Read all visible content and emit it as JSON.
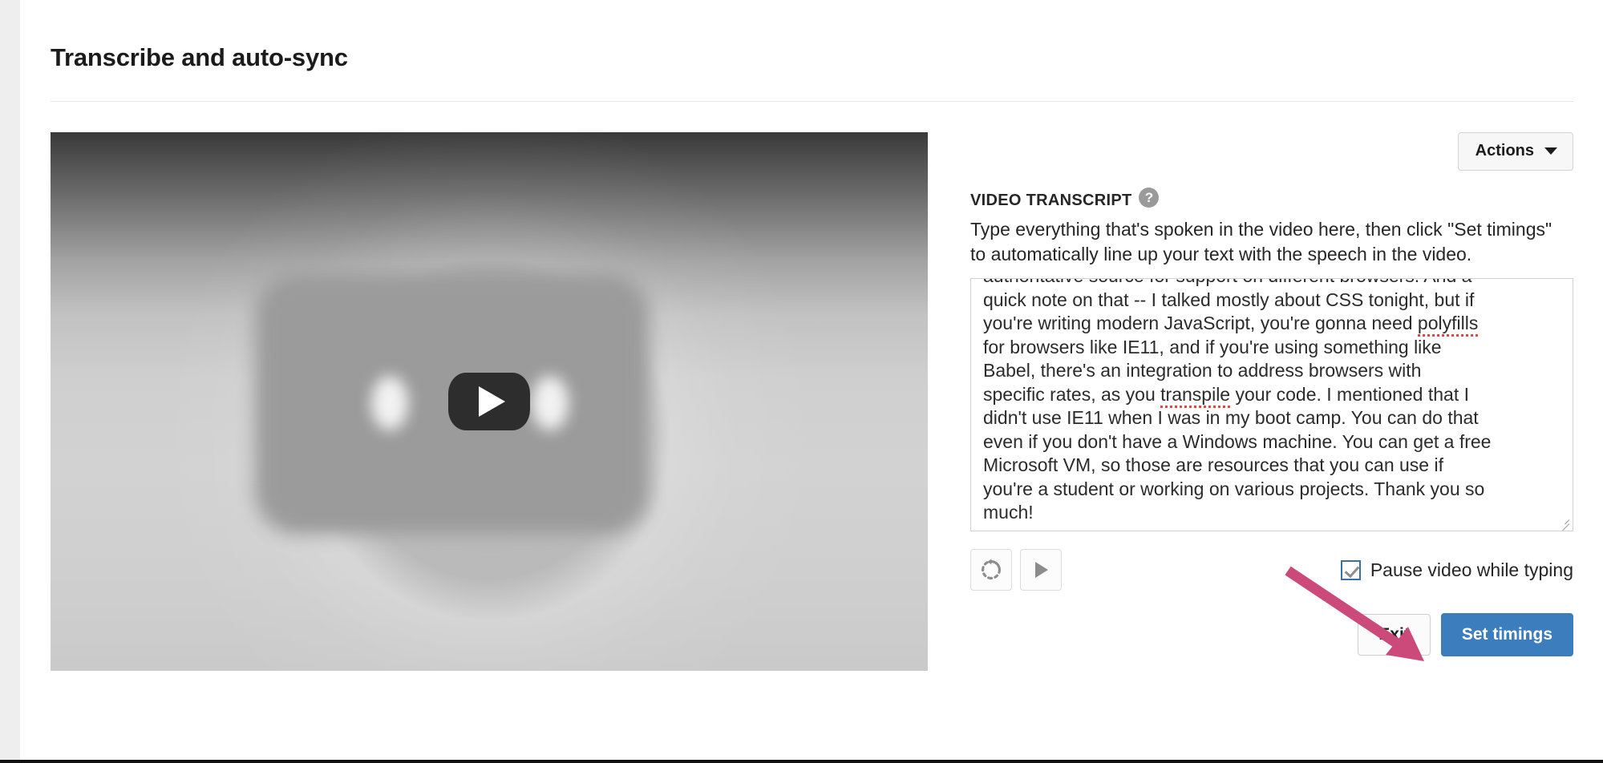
{
  "page": {
    "title": "Transcribe and auto-sync",
    "background_color": "#eeeeee",
    "card_color": "#ffffff"
  },
  "video": {
    "play_button_label": "play-video",
    "thumbnail_description": "blurred grayscale video frame"
  },
  "toolbar": {
    "actions_label": "Actions"
  },
  "transcript": {
    "section_label": "VIDEO TRANSCRIPT",
    "help_icon_glyph": "?",
    "help_text": "Type everything that's spoken in the video here, then click \"Set timings\" to automatically line up your text with the speech in the video.",
    "clipped_top_line": "authoritative source for support on different browsers. And a",
    "body_lines": [
      "quick note on that -- I talked mostly about CSS tonight, but if",
      "you're writing modern JavaScript, you're gonna need polyfills",
      "for browsers like IE11, and if you're using something like",
      "Babel, there's an integration to address browsers with",
      "specific rates, as you transpile your code. I mentioned that I",
      "didn't use IE11 when I was in my boot camp. You can do that",
      "even if you don't have a Windows machine. You can get a free",
      "Microsoft VM, so those are resources that you can use if",
      "you're a student or working on various projects. Thank you so",
      "much!"
    ],
    "misspelled_words": [
      "polyfills",
      "transpile"
    ]
  },
  "controls": {
    "replay_icon": "replay-icon",
    "play_icon": "play-icon",
    "pause_checkbox_label": "Pause video while typing",
    "pause_checkbox_checked": true
  },
  "footer": {
    "exit_label": "Exit",
    "set_timings_label": "Set timings"
  },
  "colors": {
    "primary_button": "#3b7dbd",
    "annotation_arrow": "#cb4a7a",
    "checkbox_border": "#3b6fa8",
    "spellcheck_underline": "#e8453c",
    "help_icon": "#9a9a9a"
  }
}
